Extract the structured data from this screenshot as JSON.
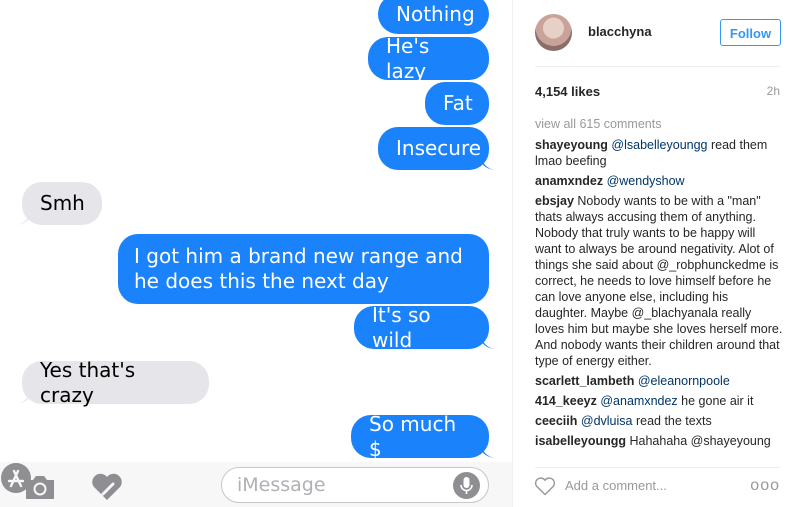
{
  "chat": {
    "messages": [
      {
        "text": "Nothing",
        "from": "me"
      },
      {
        "text": "He's lazy",
        "from": "me"
      },
      {
        "text": "Fat",
        "from": "me"
      },
      {
        "text": "Insecure",
        "from": "me"
      },
      {
        "text": "Smh",
        "from": "them"
      },
      {
        "text": "I got him a brand new range and he does this the next day",
        "from": "me"
      },
      {
        "text": "It's so wild",
        "from": "me"
      },
      {
        "text": "Yes that's crazy",
        "from": "them"
      },
      {
        "text": "So much $",
        "from": "me"
      }
    ],
    "compose": {
      "placeholder": "iMessage",
      "icons": [
        "camera-icon",
        "digital-touch-heart-icon",
        "app-store-icon",
        "microphone-icon"
      ]
    },
    "colors": {
      "sent": "#1a82fb",
      "received": "#e5e5ea"
    }
  },
  "post": {
    "username": "blacchyna",
    "follow_label": "Follow",
    "likes": "4,154 likes",
    "time": "2h",
    "view_all": "view all 615 comments",
    "comments": [
      {
        "user": "shayeyoung",
        "mention": "@lsabelleyoungg",
        "text": " read them lmao beefing"
      },
      {
        "user": "anamxndez",
        "mention": "@wendyshow",
        "text": ""
      },
      {
        "user": "ebsjay",
        "mention": "",
        "text": "Nobody wants to be with a \"man\" thats always accusing them of anything. Nobody that truly wants to be happy will want to always be around negativity. Alot of things she said about @_robphunckedme is correct, he needs to love himself before he can love anyone else, including his daughter. Maybe @_blachyanala really loves him but maybe she loves herself more. And nobody wants their children around that type of energy either."
      },
      {
        "user": "scarlett_lambeth",
        "mention": "@eleanornpoole",
        "text": ""
      },
      {
        "user": "414_keeyz",
        "mention": "@anamxndez",
        "text": " he gone air it"
      },
      {
        "user": "ceeciih",
        "mention": "@dvluisa",
        "text": " read the texts"
      },
      {
        "user": "isabelleyoungg",
        "mention": "",
        "text": "Hahahaha @shayeyoung"
      }
    ],
    "add_comment_placeholder": "Add a comment...",
    "more_label": "ooo",
    "accent": "#3897f0"
  }
}
